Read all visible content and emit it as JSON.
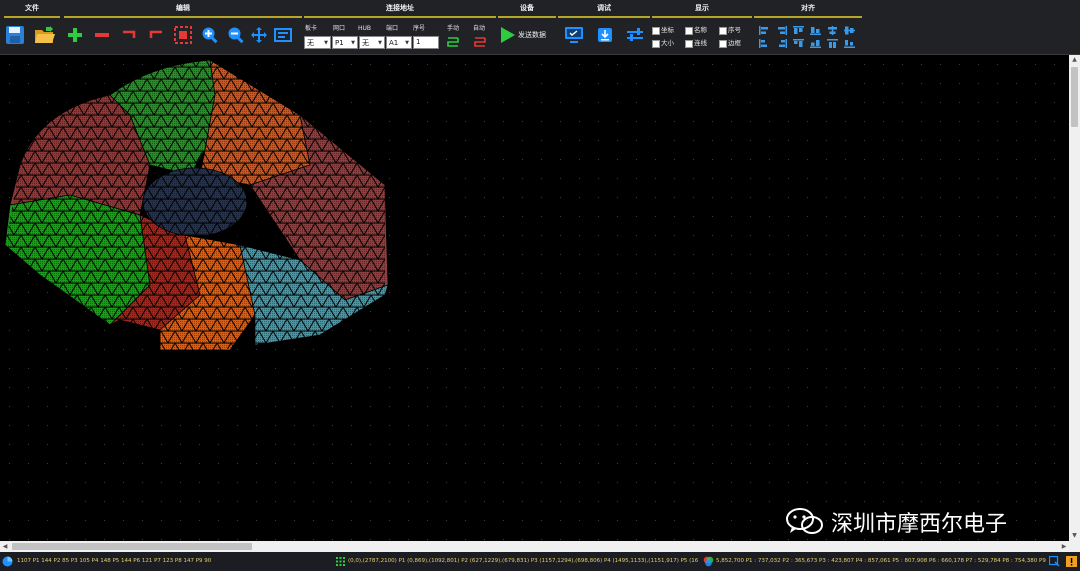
{
  "toolbar": {
    "groups": {
      "file": "文件",
      "edit": "编辑",
      "connection": "连接地址",
      "device": "设备",
      "debug": "调试",
      "display": "显示",
      "align": "对齐"
    },
    "labels": {
      "card": "板卡",
      "port": "网口",
      "hub": "HUB",
      "interface": "端口",
      "seq": "序号",
      "manual": "手动",
      "auto": "自动"
    },
    "selects": {
      "card": "无",
      "port": "P1",
      "hub": "无",
      "interface": "A1"
    },
    "seq_value": "1",
    "send_data": "发送数据",
    "display_checks": {
      "coord": "坐标",
      "name": "名称",
      "seq": "序号",
      "size": "大小",
      "wire": "连线",
      "border": "边框"
    }
  },
  "status": {
    "left": "1107 P1 144 P2 85 P3 105 P4 148 P5 144 P6 121 P7 123 P8 147 P9 90",
    "middle": "(0,0),(2787,2100) P1 (0,869),(1092,801) P2 (627,1229),(679,831) P3 (1157,1294),(698,806) P4 (1495,1133),(1151,917) P5 (16",
    "right": "5,852,700 P1 : 737,032 P2 : 365,673 P3 : 423,807 P4 : 857,061 P5 : 807,908 P6 : 660,178 P7 : 529,784 P8 : 754,380 P9"
  },
  "watermark": "深圳市摩西尔电子",
  "colors": {
    "group_line": "#b5a528",
    "status_text": "#e3cf6e",
    "accent_blue": "#1e90ff",
    "accent_green": "#2ecc40",
    "accent_red": "#e53935"
  },
  "regions": [
    {
      "name": "red-north-west",
      "color": "#8b3a3a"
    },
    {
      "name": "green-north",
      "color": "#2f8a2f"
    },
    {
      "name": "orange-north-east",
      "color": "#c05a2a"
    },
    {
      "name": "brown-east",
      "color": "#8a4040"
    },
    {
      "name": "green-west",
      "color": "#1f9a1f"
    },
    {
      "name": "red-south-west",
      "color": "#9a2a20"
    },
    {
      "name": "orange-south",
      "color": "#d2601c"
    },
    {
      "name": "cyan-south-east",
      "color": "#4f93a0"
    },
    {
      "name": "navy-center",
      "color": "#26314a"
    }
  ]
}
